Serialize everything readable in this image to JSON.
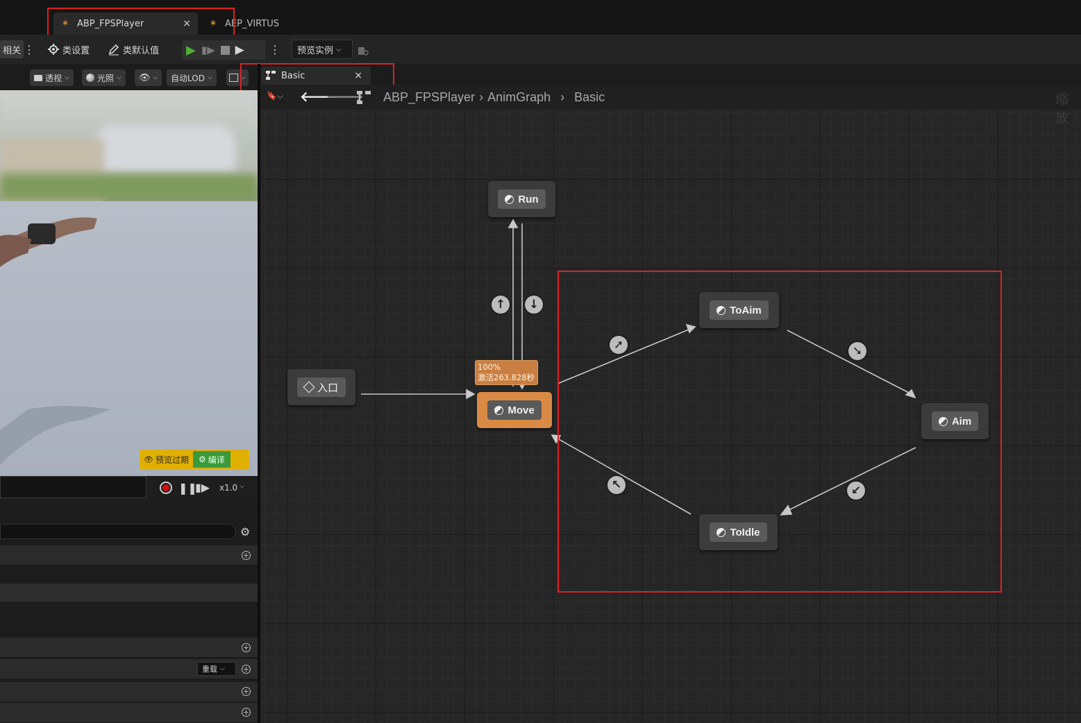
{
  "tabs": [
    {
      "label": "ABP_FPSPlayer",
      "close": "×"
    },
    {
      "label": "AEP_VIRTUS"
    }
  ],
  "toolbar": {
    "related_label": "相关",
    "class_settings": "类设置",
    "class_defaults": "类默认值",
    "preview_instance": "预览实例"
  },
  "viewport_toolbar": {
    "perspective": "透视",
    "lighting": "光照",
    "auto_lod": "自动LOD"
  },
  "graph_tab": {
    "label": "Basic",
    "close": "×"
  },
  "breadcrumb": [
    "ABP_FPSPlayer",
    "AnimGraph",
    "Basic"
  ],
  "zoom_label": "缩放",
  "preview_badge": {
    "expired": "预览过期",
    "compile": "编译"
  },
  "playback": {
    "speed": "x1.0"
  },
  "panel": {
    "reload_label": "重载"
  },
  "graph": {
    "entry_label": "入口",
    "states": [
      "Run",
      "Move",
      "ToAim",
      "Aim",
      "ToIdle"
    ],
    "active_state": "Move",
    "tooltip_percent": "100%",
    "tooltip_active": "激活263.828秒"
  },
  "colors": {
    "active_node": "#d98a45",
    "highlight_box": "#e02020",
    "play_green": "#4caf32",
    "compile_green": "#3a9a3a",
    "badge_yellow": "#e0b000"
  }
}
